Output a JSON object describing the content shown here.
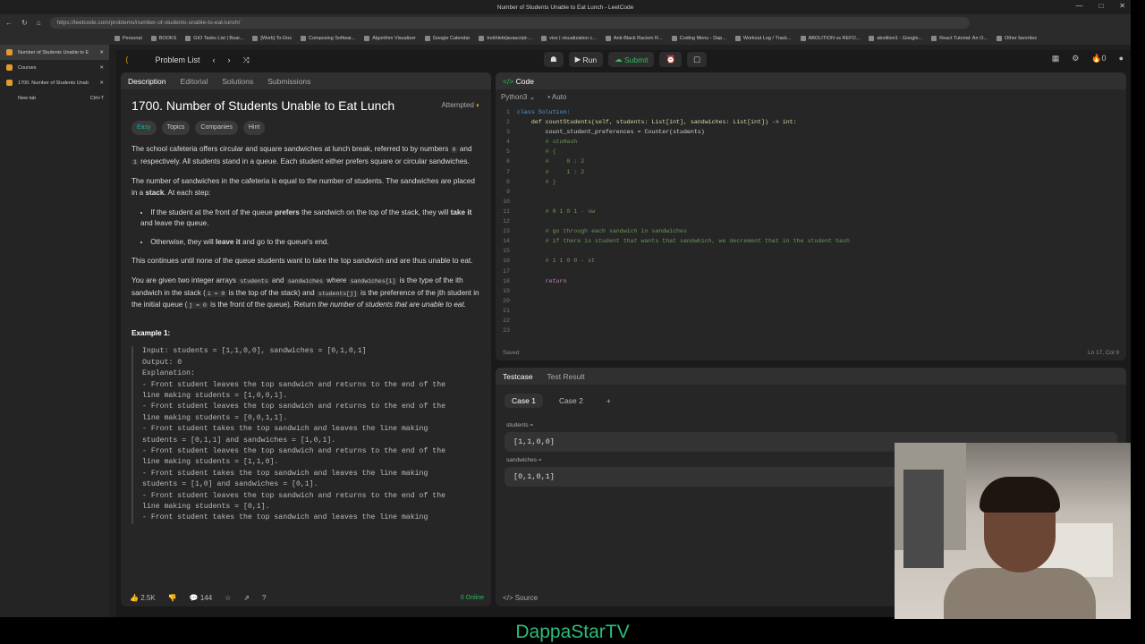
{
  "browser": {
    "window_title": "Number of Students Unable to Eat Lunch - LeetCode",
    "url": "https://leetcode.com/problems/number-of-students-unable-to-eat-lunch/",
    "bookmarks": [
      "Personal",
      "BOOKS",
      "GIO Tasks List | Boar...",
      "[Work] To-Dos",
      "Composing Softwar...",
      "Algorithm Visualizer",
      "Google Calendar",
      "trekhleb/javascript-...",
      "visx | visualization c...",
      "Anti-Black Racism R...",
      "Coding Menu - Dap...",
      "Workout Log / Track...",
      "ABOLITION vs REFO...",
      "abolition1 - Google...",
      "React Tutorial: An O...",
      "Other favorites"
    ],
    "tabs": [
      {
        "label": "Number of Students Unable to E",
        "active": true
      },
      {
        "label": "Courses",
        "active": false
      },
      {
        "label": "1700. Number of Students Unab",
        "active": false
      }
    ],
    "new_tab": {
      "label": "New tab",
      "shortcut": "Ctrl+T"
    }
  },
  "leetcode": {
    "problem_list": "Problem List",
    "run_label": "Run",
    "submit_label": "Submit",
    "streak": "0",
    "desc_tabs": [
      "Description",
      "Editorial",
      "Solutions",
      "Submissions"
    ],
    "title": "1700. Number of Students Unable to Eat Lunch",
    "status": "Attempted",
    "chips": [
      "Easy",
      "Topics",
      "Companies",
      "Hint"
    ],
    "paragraphs": {
      "p1a": "The school cafeteria offers circular and square sandwiches at lunch break, referred to by numbers ",
      "p1b": " and ",
      "p1c": " respectively. All students stand in a queue. Each student either prefers square or circular sandwiches.",
      "p2a": "The number of sandwiches in the cafeteria is equal to the number of students. The sandwiches are placed in a ",
      "p2b": "stack",
      "p2c": ". At each step:",
      "b1a": "If the student at the front of the queue ",
      "b1b": "prefers",
      "b1c": " the sandwich on the top of the stack, they will ",
      "b1d": "take it",
      "b1e": " and leave the queue.",
      "b2a": "Otherwise, they will ",
      "b2b": "leave it",
      "b2c": " and go to the queue's end.",
      "p3": "This continues until none of the queue students want to take the top sandwich and are thus unable to eat.",
      "p4a": "You are given two integer arrays ",
      "p4b": " and ",
      "p4c": " where ",
      "p4d": " is the type of the ",
      "p4e": " sandwich in the stack (",
      "p4f": " is the top of the stack) and ",
      "p4g": " is the preference of the ",
      "p4h": " student in the initial queue (",
      "p4i": " is the front of the queue). Return ",
      "p4j": "the number of students that are unable to eat.",
      "c0": "0",
      "c1": "1",
      "students": "students",
      "sandwiches": "sandwiches",
      "sw_i": "sandwiches[i]",
      "ith": "ith",
      "i0": "i = 0",
      "st_j": "students[j]",
      "jth": "jth",
      "j0": "j = 0"
    },
    "example_title": "Example 1:",
    "example_lines": [
      "Input: students = [1,1,0,0], sandwiches = [0,1,0,1]",
      "Output: 0",
      "Explanation:",
      "- Front student leaves the top sandwich and returns to the end of the",
      "line making students = [1,0,0,1].",
      "- Front student leaves the top sandwich and returns to the end of the",
      "line making students = [0,0,1,1].",
      "- Front student takes the top sandwich and leaves the line making",
      "students = [0,1,1] and sandwiches = [1,0,1].",
      "- Front student leaves the top sandwich and returns to the end of the",
      "line making students = [1,1,0].",
      "- Front student takes the top sandwich and leaves the line making",
      "students = [1,0] and sandwiches = [0,1].",
      "- Front student leaves the top sandwich and returns to the end of the",
      "line making students = [0,1].",
      "- Front student takes the top sandwich and leaves the line making"
    ],
    "likes": "2.5K",
    "comments": "144",
    "online": "0 Online",
    "code_title": "Code",
    "language": "Python3",
    "auto": "Auto",
    "saved": "Saved",
    "cursor": "Ln 17, Col 9",
    "test_tabs": [
      "Testcase",
      "Test Result"
    ],
    "cases": [
      "Case 1",
      "Case 2"
    ],
    "inputs": [
      {
        "label": "students =",
        "value": "[1,1,0,0]"
      },
      {
        "label": "sandwiches =",
        "value": "[0,1,0,1]"
      }
    ],
    "source": "Source"
  },
  "code_lines": [
    {
      "n": "1",
      "t": "class Solution:",
      "c": "kw"
    },
    {
      "n": "2",
      "t": "    def countStudents(self, students: List[int], sandwiches: List[int]) -> int:",
      "c": "fn"
    },
    {
      "n": "3",
      "t": "        count_student_preferences = Counter(students)",
      "c": ""
    },
    {
      "n": "4",
      "t": "        # stuHash",
      "c": "cm"
    },
    {
      "n": "5",
      "t": "        # {",
      "c": "cm"
    },
    {
      "n": "6",
      "t": "        #     0 : 2",
      "c": "cm"
    },
    {
      "n": "7",
      "t": "        #     1 : 2",
      "c": "cm"
    },
    {
      "n": "8",
      "t": "        # }",
      "c": "cm"
    },
    {
      "n": "9",
      "t": "",
      "c": ""
    },
    {
      "n": "10",
      "t": "",
      "c": ""
    },
    {
      "n": "11",
      "t": "        # 0 1 0 1 - sw",
      "c": "cm"
    },
    {
      "n": "12",
      "t": "",
      "c": ""
    },
    {
      "n": "13",
      "t": "        # go through each sandwich in sandwiches",
      "c": "cm"
    },
    {
      "n": "14",
      "t": "        # if there is student that wants that sandwhich, we decrement that in the student hash",
      "c": "cm"
    },
    {
      "n": "15",
      "t": "",
      "c": ""
    },
    {
      "n": "16",
      "t": "        # 1 1 0 0 - st",
      "c": "cm"
    },
    {
      "n": "17",
      "t": "",
      "c": ""
    },
    {
      "n": "18",
      "t": "        return",
      "c": "rt"
    },
    {
      "n": "19",
      "t": "",
      "c": ""
    },
    {
      "n": "20",
      "t": "",
      "c": ""
    },
    {
      "n": "21",
      "t": "",
      "c": ""
    },
    {
      "n": "22",
      "t": "",
      "c": ""
    },
    {
      "n": "23",
      "t": "",
      "c": ""
    }
  ],
  "caption": "DappaStarTV"
}
